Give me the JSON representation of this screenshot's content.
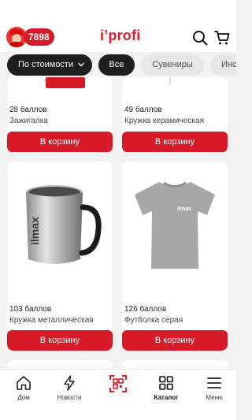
{
  "header": {
    "points": "7898",
    "logo": "i’profi"
  },
  "filters": {
    "sort_label": "По стоимости",
    "chips": [
      "Все",
      "Сувениры",
      "Инс"
    ]
  },
  "products": [
    {
      "price": "28 баллов",
      "name": "Зажигалка",
      "button": "В корзину"
    },
    {
      "price": "49 баллов",
      "name": "Кружка керамическая",
      "button": "В корзину"
    },
    {
      "price": "103 баллов",
      "name": "Кружка металлическая",
      "button": "В корзину",
      "brand": "ilmax"
    },
    {
      "price": "126 баллов",
      "name": "Футболка серая",
      "button": "В корзину",
      "brand": "ilmax"
    }
  ],
  "nav": {
    "items": [
      {
        "label": "Дом",
        "icon": "home-icon"
      },
      {
        "label": "Новости",
        "icon": "lightning-icon"
      },
      {
        "label": "",
        "icon": "qr-scan-icon"
      },
      {
        "label": "Каталог",
        "icon": "grid-icon"
      },
      {
        "label": "Меню",
        "icon": "menu-icon"
      }
    ]
  },
  "colors": {
    "accent": "#d71a28",
    "dark_chip": "#1e1e1e",
    "light_chip": "#e6e6e6"
  }
}
